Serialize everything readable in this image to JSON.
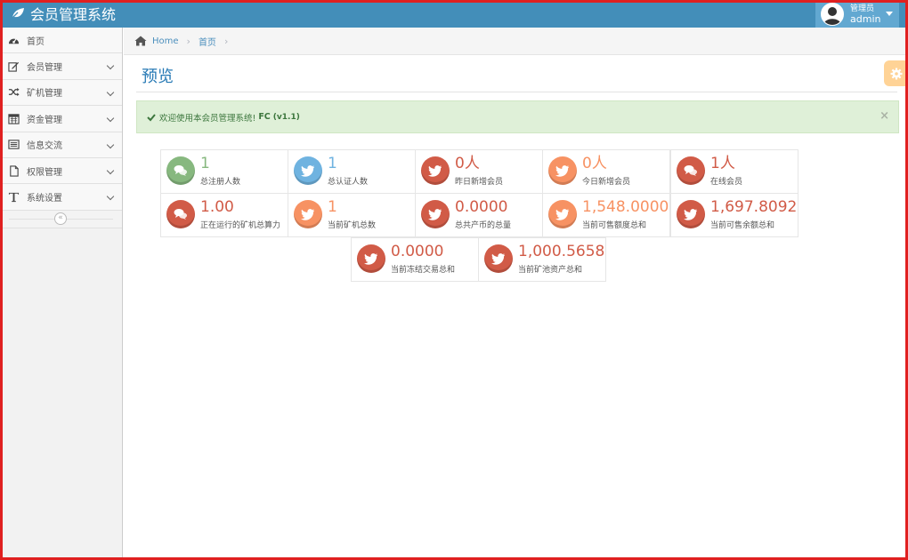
{
  "app": {
    "title": "会员管理系统"
  },
  "user": {
    "role": "管理员",
    "name": "admin"
  },
  "colors": {
    "navbar": "#438eb9",
    "accent": "#2679b5",
    "green": "#87b87f",
    "blue": "#6fb3e0",
    "red": "#d15b47",
    "orange": "#f79263"
  },
  "sidebar": {
    "items": [
      {
        "label": "首页",
        "icon": "dashboard-icon",
        "has_children": false
      },
      {
        "label": "会员管理",
        "icon": "edit-icon",
        "has_children": true
      },
      {
        "label": "矿机管理",
        "icon": "shuffle-icon",
        "has_children": true
      },
      {
        "label": "资金管理",
        "icon": "calendar-icon",
        "has_children": true
      },
      {
        "label": "信息交流",
        "icon": "list-icon",
        "has_children": true
      },
      {
        "label": "权限管理",
        "icon": "file-icon",
        "has_children": true
      },
      {
        "label": "系统设置",
        "icon": "text-icon",
        "has_children": true
      }
    ],
    "collapse_glyph": "«"
  },
  "breadcrumb": {
    "home": "Home",
    "current": "首页",
    "sep": "›"
  },
  "page": {
    "title": "预览"
  },
  "alert": {
    "text": "欢迎使用本会员管理系统!",
    "bold": "FC",
    "version": "(v1.1)",
    "close": "×"
  },
  "stats": [
    {
      "value": "1",
      "label": "总注册人数",
      "color": "green",
      "icon": "comments-icon"
    },
    {
      "value": "1",
      "label": "总认证人数",
      "color": "blue",
      "icon": "twitter-icon"
    },
    {
      "value": "0人",
      "label": "昨日新增会员",
      "color": "red",
      "icon": "twitter-icon"
    },
    {
      "value": "0人",
      "label": "今日新增会员",
      "color": "orange",
      "icon": "twitter-icon"
    },
    {
      "value": "1人",
      "label": "在线会员",
      "color": "red",
      "icon": "comments-icon"
    },
    {
      "value": "1.00",
      "label": "正在运行的矿机总算力",
      "color": "red",
      "icon": "comments-icon"
    },
    {
      "value": "1",
      "label": "当前矿机总数",
      "color": "orange",
      "icon": "twitter-icon"
    },
    {
      "value": "0.0000",
      "label": "总共产币的总量",
      "color": "red",
      "icon": "twitter-icon"
    },
    {
      "value": "1,548.0000",
      "label": "当前可售额度总和",
      "color": "orange",
      "icon": "twitter-icon"
    },
    {
      "value": "1,697.8092",
      "label": "当前可售余额总和",
      "color": "red",
      "icon": "twitter-icon"
    },
    {
      "value": "0.0000",
      "label": "当前冻结交易总和",
      "color": "red",
      "icon": "twitter-icon"
    },
    {
      "value": "1,000.5658",
      "label": "当前矿池资产总和",
      "color": "red",
      "icon": "twitter-icon"
    }
  ]
}
